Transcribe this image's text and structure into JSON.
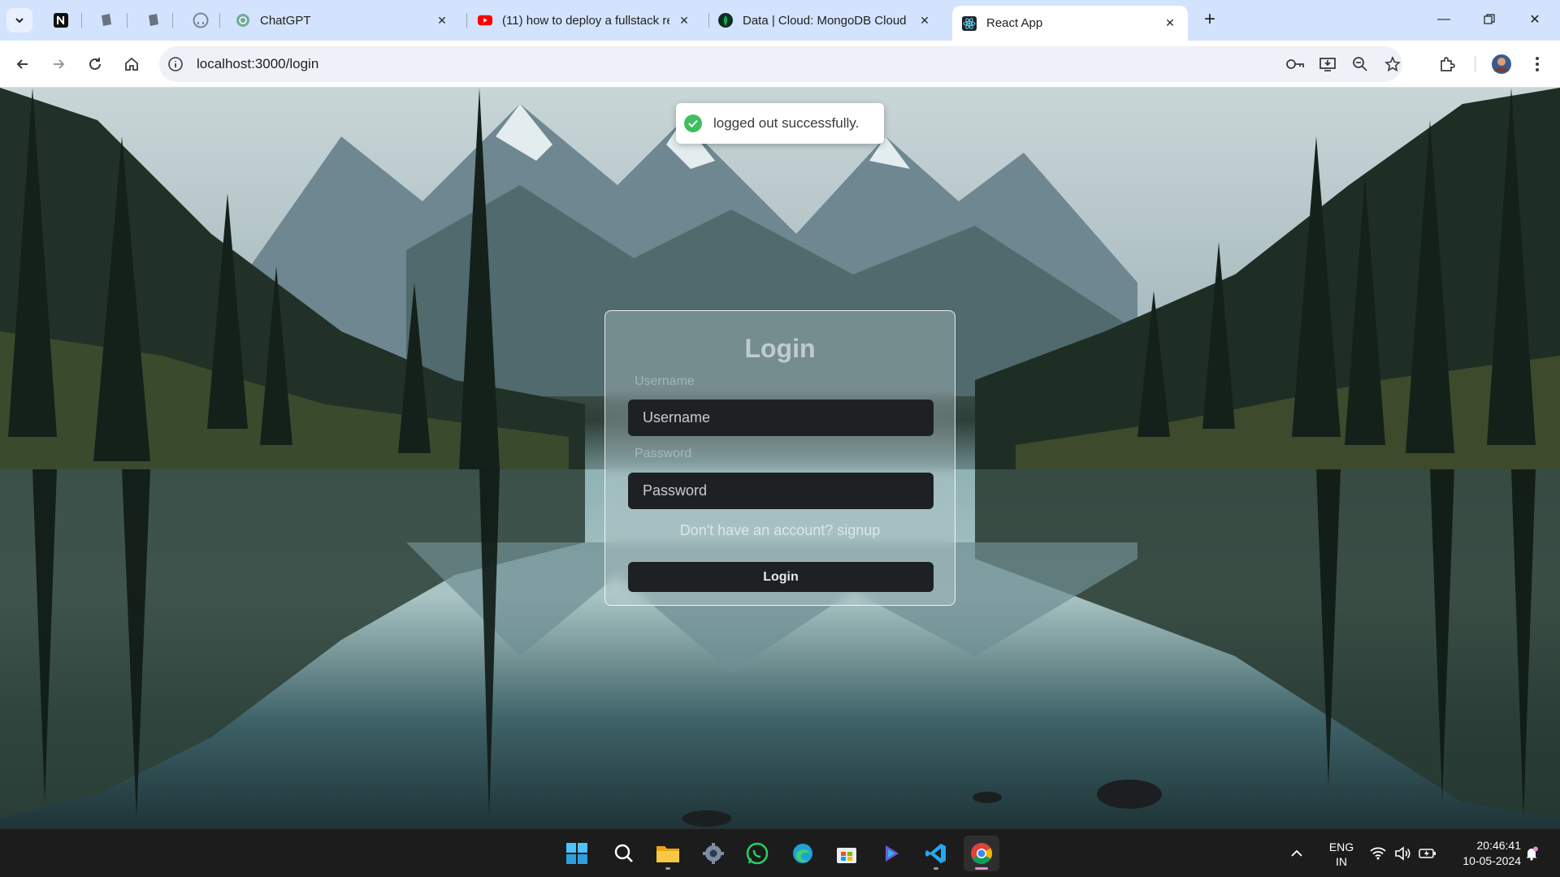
{
  "browser": {
    "tabs": [
      {
        "title": "ChatGPT",
        "icon": "chatgpt-icon"
      },
      {
        "title": "(11) how to deploy a fullstack re",
        "icon": "youtube-icon"
      },
      {
        "title": "Data | Cloud: MongoDB Cloud",
        "icon": "mongodb-icon"
      },
      {
        "title": "React App",
        "icon": "react-icon",
        "active": true
      }
    ],
    "address": "localhost:3000/login",
    "colors": {
      "tabstrip": "#d3e3fd",
      "toolbar": "#ffffff"
    }
  },
  "toast": {
    "message": "logged out successfully.",
    "color": "#3fbf5e"
  },
  "login": {
    "title": "Login",
    "username_label": "Username",
    "username_placeholder": "Username",
    "password_label": "Password",
    "password_placeholder": "Password",
    "signup_text": "Don't have an account? signup",
    "button_label": "Login"
  },
  "taskbar": {
    "language": "ENG",
    "region": "IN",
    "time": "20:46:41",
    "date": "10-05-2024"
  }
}
